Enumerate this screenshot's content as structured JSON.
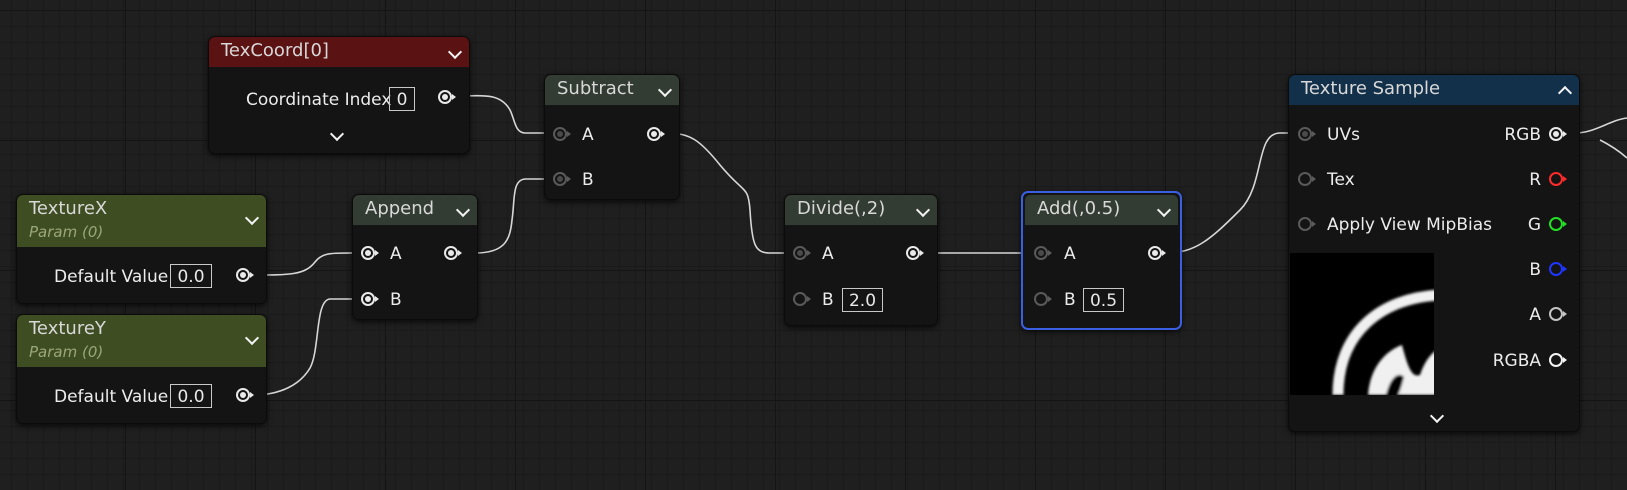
{
  "nodes": {
    "texcoord": {
      "title": "TexCoord[0]",
      "coordinate_index_label": "Coordinate Index",
      "coordinate_index_value": "0"
    },
    "texturex": {
      "title": "TextureX",
      "subtitle": "Param (0)",
      "default_label": "Default Value",
      "default_value": "0.0"
    },
    "texturey": {
      "title": "TextureY",
      "subtitle": "Param (0)",
      "default_label": "Default Value",
      "default_value": "0.0"
    },
    "append": {
      "title": "Append",
      "pin_a": "A",
      "pin_b": "B"
    },
    "subtract": {
      "title": "Subtract",
      "pin_a": "A",
      "pin_b": "B"
    },
    "divide": {
      "title": "Divide(,2)",
      "pin_a": "A",
      "pin_b": "B",
      "b_value": "2.0"
    },
    "add": {
      "title": "Add(,0.5)",
      "pin_a": "A",
      "pin_b": "B",
      "b_value": "0.5"
    },
    "texture_sample": {
      "title": "Texture Sample",
      "inputs": [
        "UVs",
        "Tex",
        "Apply View MipBias"
      ],
      "outputs": [
        "RGB",
        "R",
        "G",
        "B",
        "A",
        "RGBA"
      ]
    }
  },
  "colors": {
    "texcoord_header": "#5a1212",
    "param_header": "#3e4d22",
    "math_header": "#323c32",
    "texture_header": "#123049",
    "selection_outline": "#3a5fe0",
    "pin_r": "#ff2a2a",
    "pin_g": "#22e022",
    "pin_b": "#1e36ff"
  }
}
